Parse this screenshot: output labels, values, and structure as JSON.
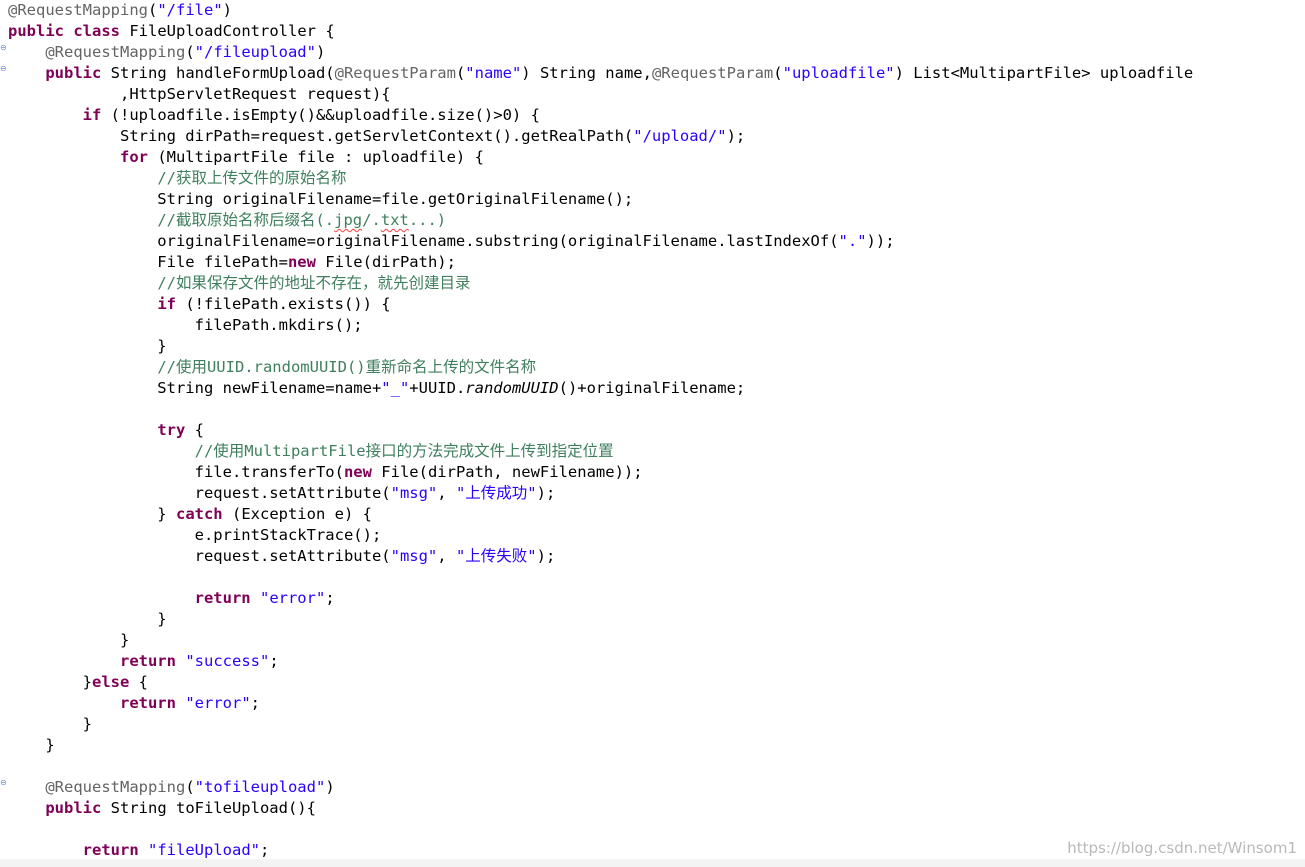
{
  "editor": {
    "lines": [
      [
        {
          "c": "ann",
          "t": "@RequestMapping"
        },
        {
          "c": "plain",
          "t": "("
        },
        {
          "c": "str",
          "t": "\"/file\""
        },
        {
          "c": "plain",
          "t": ")"
        }
      ],
      [
        {
          "c": "kw",
          "t": "public"
        },
        {
          "c": "plain",
          "t": " "
        },
        {
          "c": "kw",
          "t": "class"
        },
        {
          "c": "plain",
          "t": " FileUploadController {"
        }
      ],
      [
        {
          "c": "plain",
          "t": "    "
        },
        {
          "c": "ann",
          "t": "@RequestMapping"
        },
        {
          "c": "plain",
          "t": "("
        },
        {
          "c": "str",
          "t": "\"/fileupload\""
        },
        {
          "c": "plain",
          "t": ")"
        }
      ],
      [
        {
          "c": "plain",
          "t": "    "
        },
        {
          "c": "kw",
          "t": "public"
        },
        {
          "c": "plain",
          "t": " String handleFormUpload("
        },
        {
          "c": "ann",
          "t": "@RequestParam"
        },
        {
          "c": "plain",
          "t": "("
        },
        {
          "c": "str",
          "t": "\"name\""
        },
        {
          "c": "plain",
          "t": ") String name,"
        },
        {
          "c": "ann",
          "t": "@RequestParam"
        },
        {
          "c": "plain",
          "t": "("
        },
        {
          "c": "str",
          "t": "\"uploadfile\""
        },
        {
          "c": "plain",
          "t": ") List<MultipartFile> uploadfile"
        }
      ],
      [
        {
          "c": "plain",
          "t": "            ,HttpServletRequest request){"
        }
      ],
      [
        {
          "c": "plain",
          "t": "        "
        },
        {
          "c": "kw",
          "t": "if"
        },
        {
          "c": "plain",
          "t": " (!uploadfile.isEmpty()&&uploadfile.size()>0) {"
        }
      ],
      [
        {
          "c": "plain",
          "t": "            String dirPath=request.getServletContext().getRealPath("
        },
        {
          "c": "str",
          "t": "\"/upload/\""
        },
        {
          "c": "plain",
          "t": ");"
        }
      ],
      [
        {
          "c": "plain",
          "t": "            "
        },
        {
          "c": "kw",
          "t": "for"
        },
        {
          "c": "plain",
          "t": " (MultipartFile file : uploadfile) {"
        }
      ],
      [
        {
          "c": "plain",
          "t": "                "
        },
        {
          "c": "com",
          "t": "//获取上传文件的原始名称"
        }
      ],
      [
        {
          "c": "plain",
          "t": "                String originalFilename=file.getOriginalFilename();"
        }
      ],
      [
        {
          "c": "plain",
          "t": "                "
        },
        {
          "c": "com",
          "t": "//截取原始名称后缀名(."
        },
        {
          "c": "com squiggle",
          "t": "jpg"
        },
        {
          "c": "com",
          "t": "/."
        },
        {
          "c": "com squiggle",
          "t": "txt"
        },
        {
          "c": "com",
          "t": "...)"
        }
      ],
      [
        {
          "c": "plain",
          "t": "                originalFilename=originalFilename.substring(originalFilename.lastIndexOf("
        },
        {
          "c": "str",
          "t": "\".\""
        },
        {
          "c": "plain",
          "t": "));"
        }
      ],
      [
        {
          "c": "plain",
          "t": "                File filePath="
        },
        {
          "c": "kw",
          "t": "new"
        },
        {
          "c": "plain",
          "t": " File(dirPath);"
        }
      ],
      [
        {
          "c": "plain",
          "t": "                "
        },
        {
          "c": "com",
          "t": "//如果保存文件的地址不存在，就先创建目录"
        }
      ],
      [
        {
          "c": "plain",
          "t": "                "
        },
        {
          "c": "kw",
          "t": "if"
        },
        {
          "c": "plain",
          "t": " (!filePath.exists()) {"
        }
      ],
      [
        {
          "c": "plain",
          "t": "                    filePath.mkdirs();"
        }
      ],
      [
        {
          "c": "plain",
          "t": "                }"
        }
      ],
      [
        {
          "c": "plain",
          "t": "                "
        },
        {
          "c": "com",
          "t": "//使用UUID.randomUUID()重新命名上传的文件名称"
        }
      ],
      [
        {
          "c": "plain",
          "t": "                String newFilename=name+"
        },
        {
          "c": "str",
          "t": "\"_\""
        },
        {
          "c": "plain",
          "t": "+UUID."
        },
        {
          "c": "plain ital",
          "t": "randomUUID"
        },
        {
          "c": "plain",
          "t": "()+originalFilename;"
        }
      ],
      [],
      [
        {
          "c": "plain",
          "t": "                "
        },
        {
          "c": "kw",
          "t": "try"
        },
        {
          "c": "plain",
          "t": " {"
        }
      ],
      [
        {
          "c": "plain",
          "t": "                    "
        },
        {
          "c": "com",
          "t": "//使用MultipartFile接口的方法完成文件上传到指定位置"
        }
      ],
      [
        {
          "c": "plain",
          "t": "                    file.transferTo("
        },
        {
          "c": "kw",
          "t": "new"
        },
        {
          "c": "plain",
          "t": " File(dirPath, newFilename));"
        }
      ],
      [
        {
          "c": "plain",
          "t": "                    request.setAttribute("
        },
        {
          "c": "str",
          "t": "\"msg\""
        },
        {
          "c": "plain",
          "t": ", "
        },
        {
          "c": "str",
          "t": "\"上传成功\""
        },
        {
          "c": "plain",
          "t": ");"
        }
      ],
      [
        {
          "c": "plain",
          "t": "                } "
        },
        {
          "c": "kw",
          "t": "catch"
        },
        {
          "c": "plain",
          "t": " (Exception e) {"
        }
      ],
      [
        {
          "c": "plain",
          "t": "                    e.printStackTrace();"
        }
      ],
      [
        {
          "c": "plain",
          "t": "                    request.setAttribute("
        },
        {
          "c": "str",
          "t": "\"msg\""
        },
        {
          "c": "plain",
          "t": ", "
        },
        {
          "c": "str",
          "t": "\"上传失败\""
        },
        {
          "c": "plain",
          "t": ");"
        }
      ],
      [],
      [
        {
          "c": "plain",
          "t": "                    "
        },
        {
          "c": "kw",
          "t": "return"
        },
        {
          "c": "plain",
          "t": " "
        },
        {
          "c": "str",
          "t": "\"error\""
        },
        {
          "c": "plain",
          "t": ";"
        }
      ],
      [
        {
          "c": "plain",
          "t": "                }"
        }
      ],
      [
        {
          "c": "plain",
          "t": "            }"
        }
      ],
      [
        {
          "c": "plain",
          "t": "            "
        },
        {
          "c": "kw",
          "t": "return"
        },
        {
          "c": "plain",
          "t": " "
        },
        {
          "c": "str",
          "t": "\"success\""
        },
        {
          "c": "plain",
          "t": ";"
        }
      ],
      [
        {
          "c": "plain",
          "t": "        }"
        },
        {
          "c": "kw",
          "t": "else"
        },
        {
          "c": "plain",
          "t": " {"
        }
      ],
      [
        {
          "c": "plain",
          "t": "            "
        },
        {
          "c": "kw",
          "t": "return"
        },
        {
          "c": "plain",
          "t": " "
        },
        {
          "c": "str",
          "t": "\"error\""
        },
        {
          "c": "plain",
          "t": ";"
        }
      ],
      [
        {
          "c": "plain",
          "t": "        }"
        }
      ],
      [
        {
          "c": "plain",
          "t": "    }"
        }
      ],
      [],
      [
        {
          "c": "plain",
          "t": "    "
        },
        {
          "c": "ann",
          "t": "@RequestMapping"
        },
        {
          "c": "plain",
          "t": "("
        },
        {
          "c": "str",
          "t": "\"tofileupload\""
        },
        {
          "c": "plain",
          "t": ")"
        }
      ],
      [
        {
          "c": "plain",
          "t": "    "
        },
        {
          "c": "kw",
          "t": "public"
        },
        {
          "c": "plain",
          "t": " String toFileUpload(){"
        }
      ],
      [],
      [
        {
          "c": "plain",
          "t": "        "
        },
        {
          "c": "kw",
          "t": "return"
        },
        {
          "c": "plain",
          "t": " "
        },
        {
          "c": "str",
          "t": "\"fileUpload\""
        },
        {
          "c": "plain",
          "t": ";"
        }
      ]
    ],
    "fold_markers": [
      {
        "line": 2,
        "glyph": "⊖"
      },
      {
        "line": 3,
        "glyph": "⊖"
      },
      {
        "line": 37,
        "glyph": "⊖"
      }
    ]
  },
  "watermark": "https://blog.csdn.net/Winsom1",
  "colors": {
    "keyword": "#7f0055",
    "annotation": "#646464",
    "string": "#2a00ff",
    "comment": "#3f7f5f",
    "text": "#000000",
    "background": "#ffffff"
  }
}
